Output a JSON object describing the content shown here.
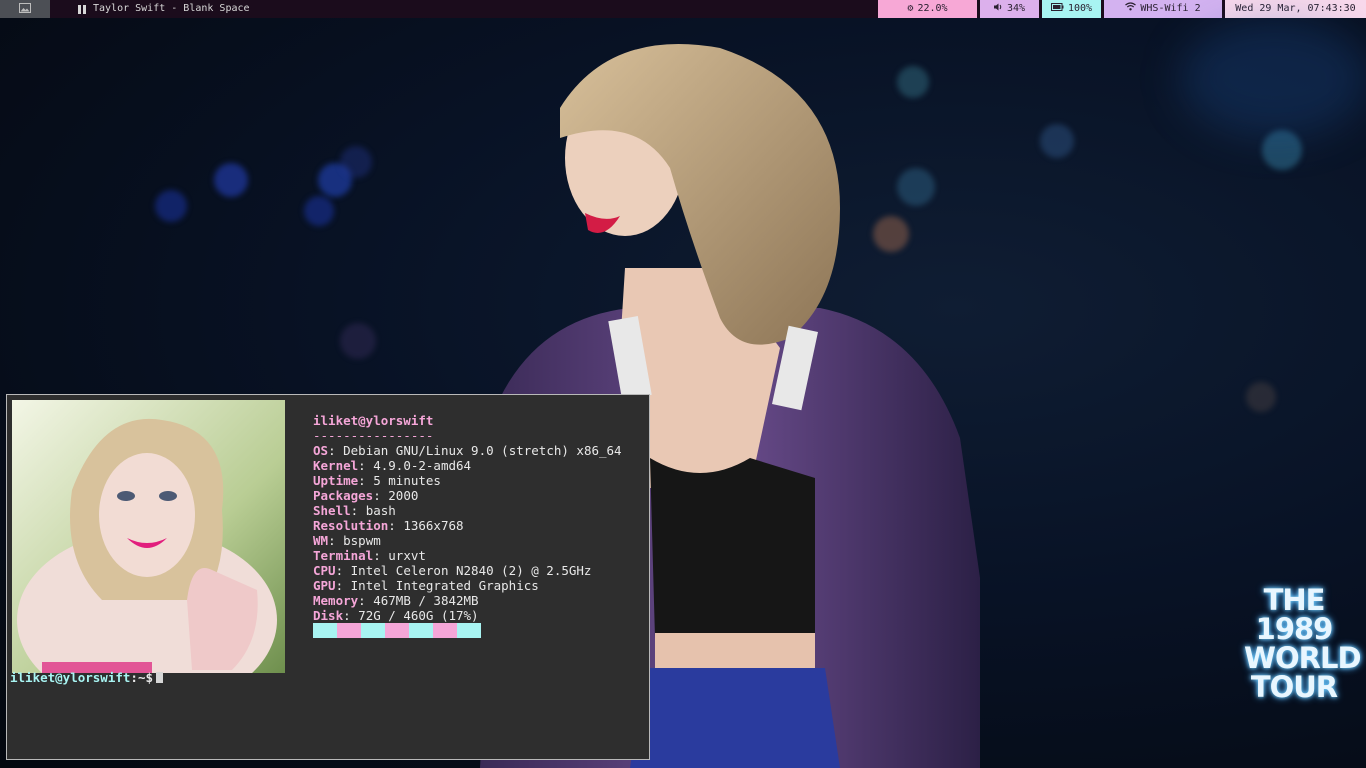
{
  "colors": {
    "accent_pink": "#f5a6d8",
    "accent_cyan": "#a8f4f2",
    "bar_bg": "#1b0c1c",
    "term_bg": "#2e2e2e"
  },
  "topbar": {
    "workspace_icon": "image-icon",
    "window_title": "Taylor Swift - Blank Space",
    "playback_icon": "pause-icon",
    "cpu": {
      "icon": "gears-icon",
      "value": "22.0%"
    },
    "volume": {
      "icon": "speaker-icon",
      "value": "34%"
    },
    "battery": {
      "icon": "battery-icon",
      "value": "100%"
    },
    "wifi": {
      "icon": "wifi-icon",
      "value": "WHS-Wifi 2"
    },
    "clock": {
      "value": "Wed 29 Mar, 07:43:30"
    }
  },
  "wallpaper": {
    "logo_lines": [
      "THE",
      "1989",
      "WORLD",
      "TOUR"
    ]
  },
  "terminal": {
    "user_host": "iliket@ylorswift",
    "separator": "----------------",
    "info": [
      {
        "key": "OS",
        "value": "Debian GNU/Linux 9.0 (stretch) x86_64"
      },
      {
        "key": "Kernel",
        "value": "4.9.0-2-amd64"
      },
      {
        "key": "Uptime",
        "value": "5 minutes"
      },
      {
        "key": "Packages",
        "value": "2000"
      },
      {
        "key": "Shell",
        "value": "bash"
      },
      {
        "key": "Resolution",
        "value": "1366x768"
      },
      {
        "key": "WM",
        "value": "bspwm"
      },
      {
        "key": "Terminal",
        "value": "urxvt"
      },
      {
        "key": "CPU",
        "value": "Intel Celeron N2840 (2) @ 2.5GHz"
      },
      {
        "key": "GPU",
        "value": "Intel Integrated Graphics"
      },
      {
        "key": "Memory",
        "value": "467MB / 3842MB"
      },
      {
        "key": "Disk",
        "value": "72G / 460G (17%)"
      }
    ],
    "color_blocks": [
      "#a8f4f2",
      "#f5a6d8",
      "#a8f4f2",
      "#f5a6d8",
      "#a8f4f2",
      "#f5a6d8",
      "#a8f4f2"
    ],
    "prompt_user": "iliket@ylorswift",
    "prompt_path": ":~$"
  }
}
